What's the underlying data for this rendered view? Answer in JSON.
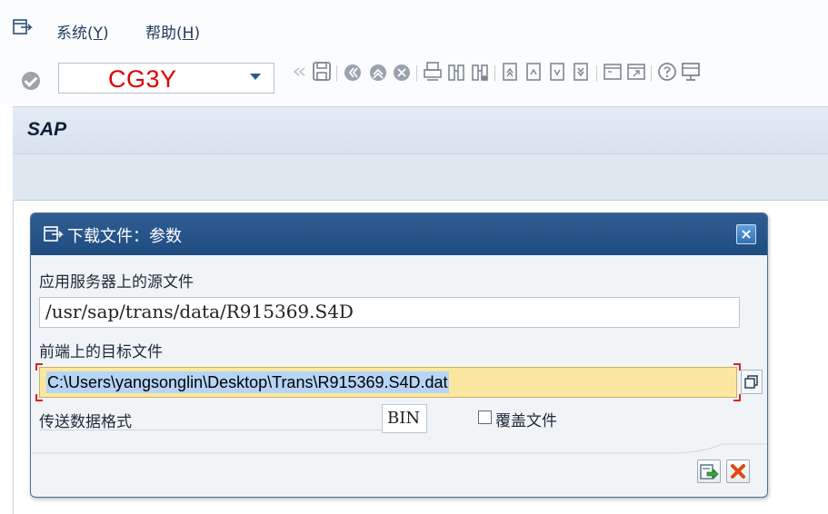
{
  "menubar": {
    "items": [
      {
        "label_main": "系统(",
        "label_key": "Y",
        "label_end": ")"
      },
      {
        "label_main": "帮助(",
        "label_key": "H",
        "label_end": ")"
      }
    ]
  },
  "toolbar": {
    "command_value": "CG3Y",
    "icons": [
      "back-icon",
      "save-icon",
      "nav-back-icon",
      "nav-exit-icon",
      "nav-cancel-icon",
      "print-icon",
      "find-icon",
      "find-next-icon",
      "first-page-icon",
      "prev-page-icon",
      "next-page-icon",
      "last-page-icon",
      "create-session-icon",
      "shortcut-icon",
      "help-icon",
      "layout-icon"
    ]
  },
  "screen": {
    "title": "SAP"
  },
  "dialog": {
    "title": "下载文件：参数",
    "close_glyph": "×",
    "source_label": "应用服务器上的源文件",
    "source_value": "/usr/sap/trans/data/R915369.S4D",
    "target_label": "前端上的目标文件",
    "target_value": "C:\\Users\\yangsonglin\\Desktop\\Trans\\R915369.S4D.dat",
    "format_label": "传送数据格式",
    "format_value": "BIN",
    "overwrite_label": "覆盖文件",
    "overwrite_checked": false
  },
  "colors": {
    "command_text": "#e00000",
    "dialog_title_bg": "#1f4c81",
    "input_highlight": "#fbe7a0",
    "selection": "#b6d4f6"
  }
}
